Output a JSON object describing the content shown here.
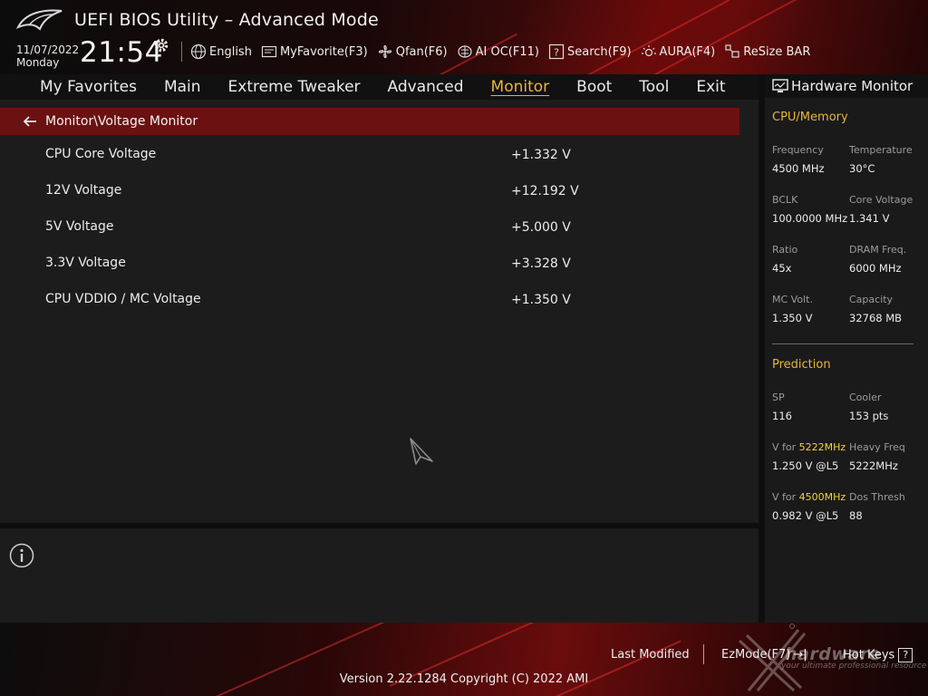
{
  "header": {
    "title": "UEFI BIOS Utility – Advanced Mode",
    "date": "11/07/2022",
    "day": "Monday",
    "time": "21:54",
    "tools": [
      {
        "icon": "globe-icon",
        "label": "English"
      },
      {
        "icon": "myfavorite-icon",
        "label": "MyFavorite(F3)"
      },
      {
        "icon": "fan-icon",
        "label": "Qfan(F6)"
      },
      {
        "icon": "ai-chip-icon",
        "label": "AI OC(F11)"
      },
      {
        "icon": "search-help-icon",
        "label": "Search(F9)"
      },
      {
        "icon": "aura-icon",
        "label": "AURA(F4)"
      },
      {
        "icon": "resize-bar-icon",
        "label": "ReSize BAR"
      }
    ]
  },
  "nav": {
    "items": [
      "My Favorites",
      "Main",
      "Extreme Tweaker",
      "Advanced",
      "Monitor",
      "Boot",
      "Tool",
      "Exit"
    ],
    "active": "Monitor"
  },
  "main": {
    "breadcrumb": "Monitor\\Voltage Monitor",
    "rows": [
      {
        "label": "CPU Core Voltage",
        "value": "+1.332 V"
      },
      {
        "label": "12V Voltage",
        "value": "+12.192 V"
      },
      {
        "label": "5V Voltage",
        "value": "+5.000 V"
      },
      {
        "label": "3.3V Voltage",
        "value": "+3.328 V"
      },
      {
        "label": "CPU VDDIO / MC Voltage",
        "value": "+1.350 V"
      }
    ]
  },
  "hardware_monitor": {
    "title": "Hardware Monitor",
    "cpu_memory": {
      "title": "CPU/Memory",
      "items": [
        {
          "label": "Frequency",
          "value": "4500 MHz"
        },
        {
          "label": "Temperature",
          "value": "30°C"
        },
        {
          "label": "BCLK",
          "value": "100.0000 MHz"
        },
        {
          "label": "Core Voltage",
          "value": "1.341 V"
        },
        {
          "label": "Ratio",
          "value": "45x"
        },
        {
          "label": "DRAM Freq.",
          "value": "6000 MHz"
        },
        {
          "label": "MC Volt.",
          "value": "1.350 V"
        },
        {
          "label": "Capacity",
          "value": "32768 MB"
        }
      ]
    },
    "prediction": {
      "title": "Prediction",
      "sp_label": "SP",
      "sp_value": "116",
      "cooler_label": "Cooler",
      "cooler_value": "153 pts",
      "vfor1_prefix": "V for ",
      "vfor1_freq": "5222MHz",
      "vfor1_value": "1.250 V @L5",
      "heavy_label": "Heavy Freq",
      "heavy_value": "5222MHz",
      "vfor2_prefix": "V for ",
      "vfor2_freq": "4500MHz",
      "vfor2_value": "0.982 V @L5",
      "dos_label": "Dos Thresh",
      "dos_value": "88"
    }
  },
  "footer": {
    "last_modified": "Last Modified",
    "ezmode": "EzMode(F7)",
    "ezmode_glyph": "→|",
    "hotkeys": "Hot Keys",
    "hotkeys_glyph": "?",
    "version": "Version 2.22.1284 Copyright (C) 2022 AMI",
    "watermark": "hardware",
    "watermark_sub": "your ultimate professional resource"
  },
  "colors": {
    "accent": "#e8b53a",
    "highlight": "#f2d33a",
    "breadcrumb_bg": "#6b1111",
    "panel_bg": "#1a1a1a"
  }
}
